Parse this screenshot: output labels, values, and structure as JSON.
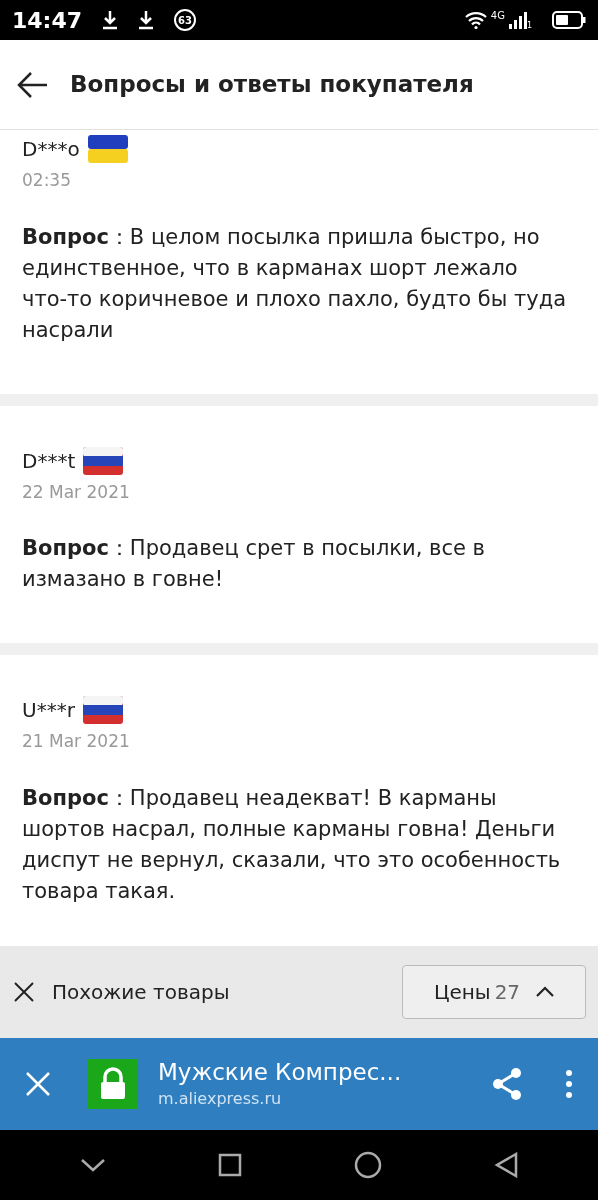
{
  "status_bar": {
    "time": "14:47",
    "badge": "63",
    "network": "4G",
    "sim": "1"
  },
  "header": {
    "title": "Вопросы и ответы покупателя"
  },
  "questions": [
    {
      "author": "D***o",
      "kind": "ukraine",
      "date": "02:35",
      "text": "**Вопрос**：В целом посылка пришла быстро, но единственное, что в карманах шорт лежало что-то коричневое и плохо пахло, будто бы туда насрали"
    },
    {
      "author": "D***t",
      "kind": "russia",
      "date": "22 Mar 2021",
      "text": "**Вопрос**：Продавец срет в посылки, все в измазано в говне!"
    },
    {
      "author": "U***r",
      "kind": "russia",
      "date": "21 Mar 2021",
      "text": "**Вопрос**：Продавец неадекват! В карманы шортов насрал, полные карманы говна! Деньги диспут не вернул, сказали, что это особенность товара такая."
    }
  ],
  "similar_bar": {
    "label": "Похожие товары",
    "prices_label": "Цены",
    "prices_count": "27"
  },
  "browser_bar": {
    "title": "Мужские Компрес...",
    "url": "m.aliexpress.ru",
    "secure": true
  }
}
